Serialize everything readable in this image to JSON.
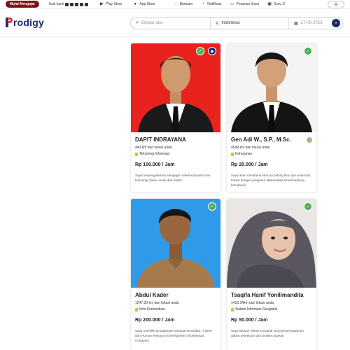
{
  "topbar": {
    "mulai_mengajar": "Mulai Mengajar",
    "ikuti_kami": "Ikuti kami",
    "play_store": "Play Store",
    "app_store": "App Store",
    "bantuan": "Bantuan",
    "notifikasi": "Notifikasi",
    "pesanan_saya": "Pesanan Saya",
    "guru": "Guru S"
  },
  "header": {
    "logo_text": "rodigy",
    "search_placeholder": "Belajar apa",
    "location_value": "Indonesia",
    "date_value": "27-08-2023"
  },
  "tutors": [
    {
      "name": "DAPIT INDRAYANA",
      "distance": "443 km dari lokasi anda",
      "subject": "Teknologi Informasi",
      "price": "Rp 100.000 / Jam",
      "description": "Saya berpengalaman mengajar materi komputer dan teknologi dasar, mulai dari materi",
      "photo_bg": "#e8231e",
      "verified": false
    },
    {
      "name": "Gen Adi W., S.P., M.Sc.",
      "distance": "4549 km dari lokasi anda",
      "subject": "Kehutanan",
      "price": "Rp 20.000 / Jam",
      "description": "Saya akan membantu semua bidang ilmu dan soal-soal terkait dengan pelajaran Matematika terkait tentang kehutanan",
      "photo_bg": "#f4f4f4",
      "verified": true
    },
    {
      "name": "Abdul Kader",
      "distance": "1247.30 km dari lokasi anda",
      "subject": "Ilmu Komunikasi",
      "price": "Rp 200.000 / Jam",
      "description": "Saya memiliki pengalaman sebagai konsultan, Trainer dan Human Resource Development di beberapa Company",
      "photo_bg": "#2f9be8",
      "verified": false
    },
    {
      "name": "Tsaqifa Hanif Yonilimandita",
      "distance": "1416.34km dari lokasi anda",
      "subject": "Sistem Informasi Geografis",
      "price": "Rp 50.000 / Jam",
      "description": "Saya lulusan Teknik Geografi yang berpengalaman dalam pemetaan dan analisis spasial",
      "photo_bg": "#e9e6e4",
      "verified": false
    }
  ]
}
